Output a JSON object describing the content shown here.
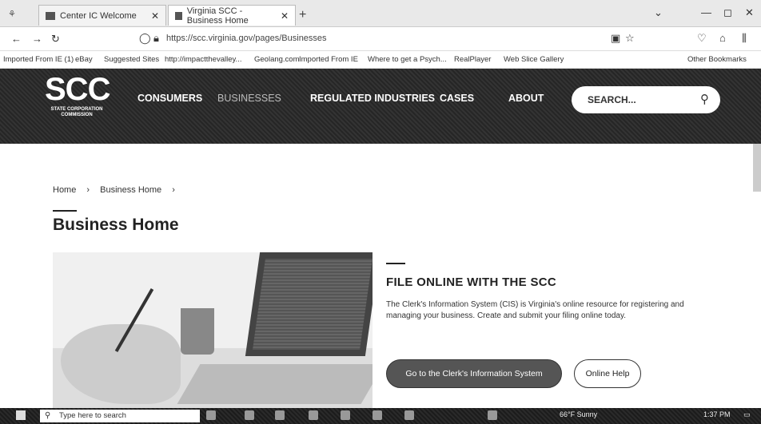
{
  "browser": {
    "tabs": [
      {
        "label": "Center IC Welcome"
      },
      {
        "label": "Virginia SCC - Business Home"
      }
    ],
    "url": "https://scc.virginia.gov/pages/Businesses",
    "bookmarks": [
      "Imported From IE (1)",
      "eBay",
      "Suggested Sites",
      "http://impactthevalley...",
      "Geolang.com",
      "Imported From IE",
      "Where to get a Psych...",
      "RealPlayer",
      "Web Slice Gallery",
      "Other Bookmarks"
    ]
  },
  "site": {
    "logo_main": "SCC",
    "logo_sub": "STATE CORPORATION COMMISSION",
    "nav": [
      "CONSUMERS",
      "BUSINESSES",
      "REGULATED INDUSTRIES",
      "CASES",
      "ABOUT"
    ],
    "search_placeholder": "SEARCH..."
  },
  "content": {
    "breadcrumb": [
      "Home",
      "Business Home"
    ],
    "page_title": "Business Home",
    "section_title": "FILE ONLINE WITH THE SCC",
    "section_body": "The Clerk's Information System (CIS) is Virginia's online resource for registering and managing your business. Create and submit your filing online today.",
    "primary_button": "Go to the Clerk's Information System",
    "secondary_button": "Online Help"
  },
  "taskbar": {
    "search_placeholder": "Type here to search",
    "weather": "66°F Sunny",
    "time": "1:37 PM"
  }
}
